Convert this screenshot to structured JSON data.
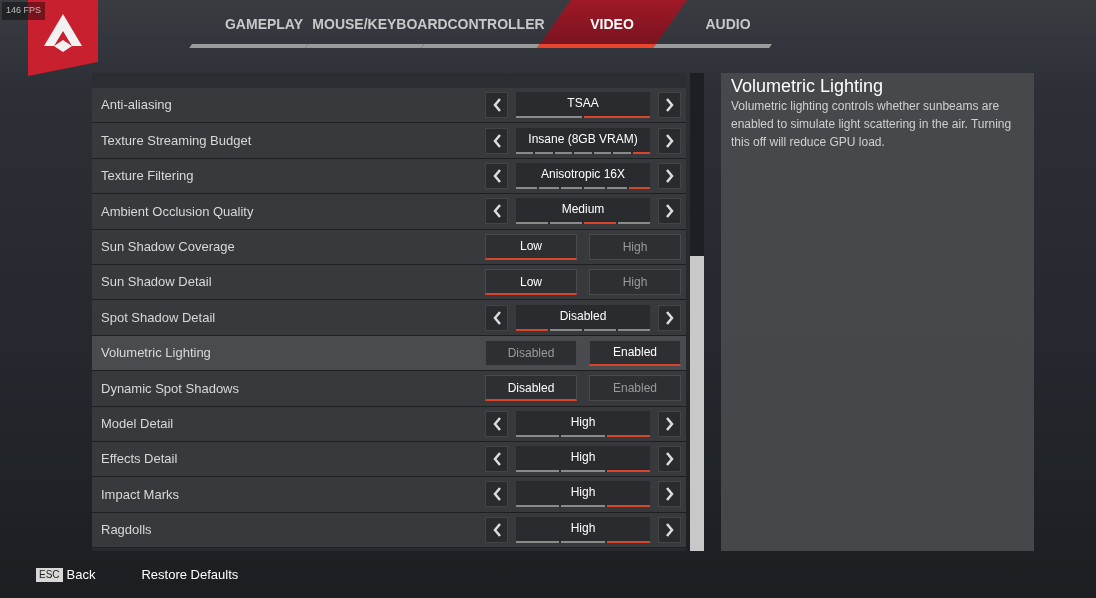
{
  "fps_counter": "146 FPS",
  "tabs": [
    {
      "label": "GAMEPLAY",
      "selected": false
    },
    {
      "label": "MOUSE/KEYBOARD",
      "selected": false
    },
    {
      "label": "CONTROLLER",
      "selected": false
    },
    {
      "label": "VIDEO",
      "selected": true
    },
    {
      "label": "AUDIO",
      "selected": false
    }
  ],
  "settings": [
    {
      "kind": "selector",
      "label": "Anti-aliasing",
      "selected": false,
      "value": "TSAA",
      "segments": [
        {
          "selected": false
        },
        {
          "selected": true
        }
      ]
    },
    {
      "kind": "selector",
      "label": "Texture Streaming Budget",
      "selected": false,
      "value": "Insane (8GB VRAM)",
      "segments": [
        {
          "selected": false
        },
        {
          "selected": false
        },
        {
          "selected": false
        },
        {
          "selected": false
        },
        {
          "selected": false
        },
        {
          "selected": false
        },
        {
          "selected": true
        }
      ]
    },
    {
      "kind": "selector",
      "label": "Texture Filtering",
      "selected": false,
      "value": "Anisotropic 16X",
      "segments": [
        {
          "selected": false
        },
        {
          "selected": false
        },
        {
          "selected": false
        },
        {
          "selected": false
        },
        {
          "selected": false
        },
        {
          "selected": true
        }
      ]
    },
    {
      "kind": "selector",
      "label": "Ambient Occlusion Quality",
      "selected": false,
      "value": "Medium",
      "segments": [
        {
          "selected": false
        },
        {
          "selected": false
        },
        {
          "selected": true
        },
        {
          "selected": false
        }
      ]
    },
    {
      "kind": "toggle",
      "label": "Sun Shadow Coverage",
      "selected": false,
      "options": [
        {
          "label": "Low",
          "selected": true
        },
        {
          "label": "High",
          "selected": false
        }
      ]
    },
    {
      "kind": "toggle",
      "label": "Sun Shadow Detail",
      "selected": false,
      "options": [
        {
          "label": "Low",
          "selected": true
        },
        {
          "label": "High",
          "selected": false
        }
      ]
    },
    {
      "kind": "selector",
      "label": "Spot Shadow Detail",
      "selected": false,
      "value": "Disabled",
      "segments": [
        {
          "selected": true
        },
        {
          "selected": false
        },
        {
          "selected": false
        },
        {
          "selected": false
        }
      ]
    },
    {
      "kind": "toggle",
      "label": "Volumetric Lighting",
      "selected": true,
      "options": [
        {
          "label": "Disabled",
          "selected": false
        },
        {
          "label": "Enabled",
          "selected": true
        }
      ]
    },
    {
      "kind": "toggle",
      "label": "Dynamic Spot Shadows",
      "selected": false,
      "options": [
        {
          "label": "Disabled",
          "selected": true
        },
        {
          "label": "Enabled",
          "selected": false
        }
      ]
    },
    {
      "kind": "selector",
      "label": "Model Detail",
      "selected": false,
      "value": "High",
      "segments": [
        {
          "selected": false
        },
        {
          "selected": false
        },
        {
          "selected": true
        }
      ]
    },
    {
      "kind": "selector",
      "label": "Effects Detail",
      "selected": false,
      "value": "High",
      "segments": [
        {
          "selected": false
        },
        {
          "selected": false
        },
        {
          "selected": true
        }
      ]
    },
    {
      "kind": "selector",
      "label": "Impact Marks",
      "selected": false,
      "value": "High",
      "segments": [
        {
          "selected": false
        },
        {
          "selected": false
        },
        {
          "selected": true
        }
      ]
    },
    {
      "kind": "selector",
      "label": "Ragdolls",
      "selected": false,
      "value": "High",
      "segments": [
        {
          "selected": false
        },
        {
          "selected": false
        },
        {
          "selected": true
        }
      ]
    }
  ],
  "description": {
    "title": "Volumetric Lighting",
    "text": "Volumetric lighting controls whether sunbeams are enabled to simulate light scattering in the air. Turning this off will reduce GPU load."
  },
  "footer": {
    "back_key": "ESC",
    "back_label": "Back",
    "restore": "Restore Defaults"
  }
}
